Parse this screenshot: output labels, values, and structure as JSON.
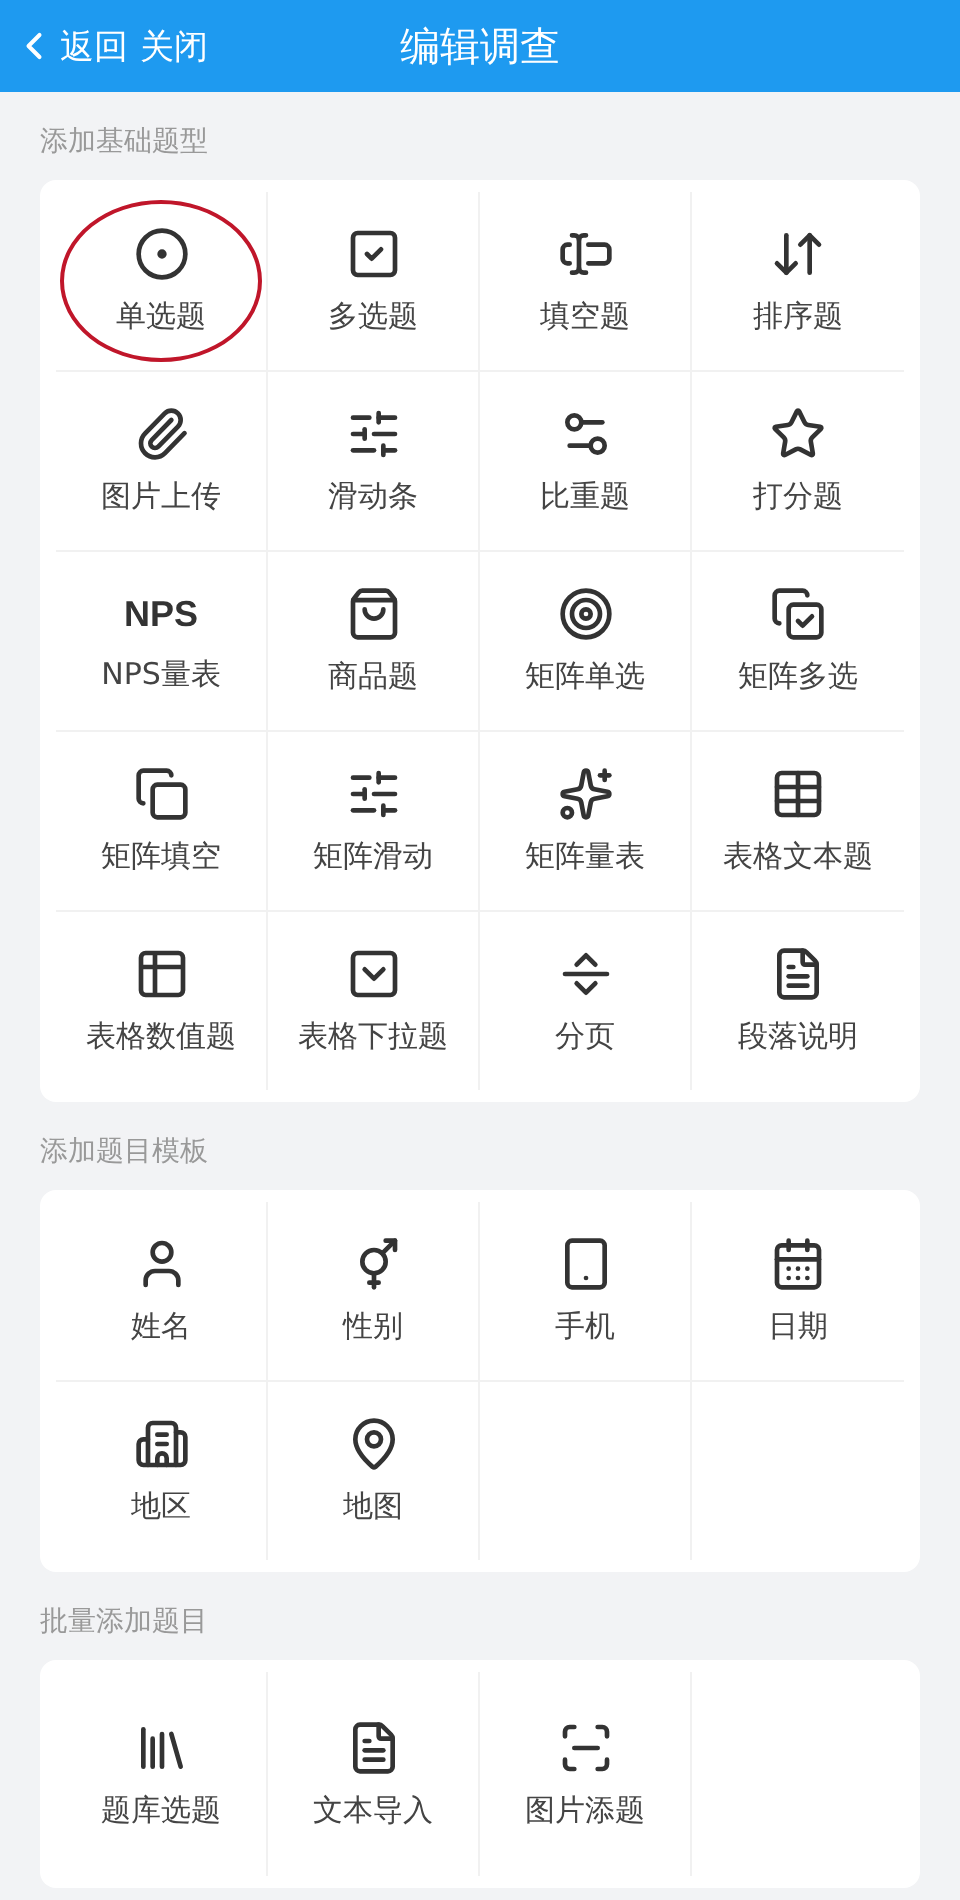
{
  "header": {
    "back": "返回",
    "close": "关闭",
    "title": "编辑调查"
  },
  "sections": [
    {
      "title": "添加基础题型",
      "items": [
        {
          "label": "单选题",
          "circled": true
        },
        {
          "label": "多选题",
          "circled": false
        },
        {
          "label": "填空题",
          "circled": false
        },
        {
          "label": "排序题",
          "circled": false
        },
        {
          "label": "图片上传",
          "circled": false
        },
        {
          "label": "滑动条",
          "circled": false
        },
        {
          "label": "比重题",
          "circled": false
        },
        {
          "label": "打分题",
          "circled": false
        },
        {
          "label": "NPS量表",
          "icon_text": "NPS",
          "circled": false
        },
        {
          "label": "商品题",
          "circled": false
        },
        {
          "label": "矩阵单选",
          "circled": false
        },
        {
          "label": "矩阵多选",
          "circled": false
        },
        {
          "label": "矩阵填空",
          "circled": false
        },
        {
          "label": "矩阵滑动",
          "circled": false
        },
        {
          "label": "矩阵量表",
          "circled": false
        },
        {
          "label": "表格文本题",
          "circled": false
        },
        {
          "label": "表格数值题",
          "circled": false
        },
        {
          "label": "表格下拉题",
          "circled": false
        },
        {
          "label": "分页",
          "circled": false
        },
        {
          "label": "段落说明",
          "circled": false
        }
      ]
    },
    {
      "title": "添加题目模板",
      "items": [
        {
          "label": "姓名",
          "circled": false
        },
        {
          "label": "性别",
          "circled": false
        },
        {
          "label": "手机",
          "circled": false
        },
        {
          "label": "日期",
          "circled": false
        },
        {
          "label": "地区",
          "circled": false
        },
        {
          "label": "地图",
          "circled": false
        }
      ]
    },
    {
      "title": "批量添加题目",
      "items": [
        {
          "label": "题库选题",
          "circled": false
        },
        {
          "label": "文本导入",
          "circled": false
        },
        {
          "label": "图片添题",
          "circled": false
        }
      ]
    }
  ]
}
